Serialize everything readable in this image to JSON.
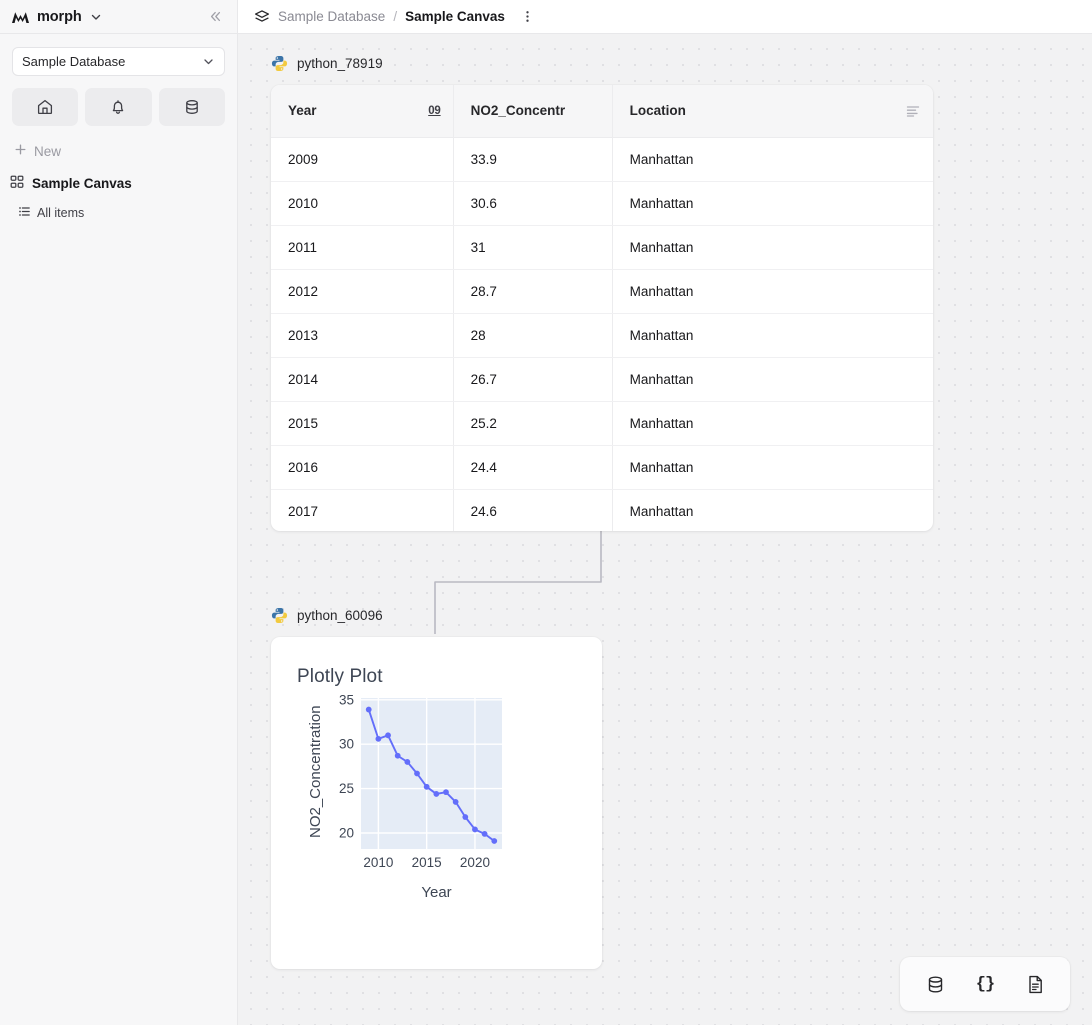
{
  "sidebar": {
    "brand": "morph",
    "brand_icon": "morph-logo-icon",
    "chevron_icon": "chevron-down-icon",
    "collapse_icon": "chevrons-left-icon",
    "db_select": {
      "value": "Sample Database",
      "arrow_icon": "chevron-down-icon"
    },
    "icon_buttons": [
      {
        "name": "home-icon",
        "label": "Home"
      },
      {
        "name": "bell-icon",
        "label": "Notifications"
      },
      {
        "name": "database-icon",
        "label": "Database"
      }
    ],
    "new_label": "New",
    "new_icon": "plus-icon",
    "canvas_item": {
      "label": "Sample Canvas",
      "icon": "grid-icon"
    },
    "all_items": {
      "label": "All items",
      "icon": "list-icon"
    }
  },
  "topbar": {
    "breadcrumb_icon": "layers-icon",
    "database": "Sample Database",
    "separator": "/",
    "canvas": "Sample Canvas",
    "menu_icon": "dots-vertical-icon"
  },
  "canvas": {
    "nodes": [
      {
        "id": "table-node",
        "label": "python_78919",
        "icon": "python-logo-icon"
      },
      {
        "id": "plot-node",
        "label": "python_60096",
        "icon": "python-logo-icon"
      }
    ],
    "table": {
      "columns": [
        {
          "label": "Year",
          "type_icon": "number-09-icon"
        },
        {
          "label": "NO2_Concentr",
          "type_icon": ""
        },
        {
          "label": "Location",
          "type_icon": "text-align-icon"
        }
      ],
      "rows": [
        [
          "2009",
          "33.9",
          "Manhattan"
        ],
        [
          "2010",
          "30.6",
          "Manhattan"
        ],
        [
          "2011",
          "31",
          "Manhattan"
        ],
        [
          "2012",
          "28.7",
          "Manhattan"
        ],
        [
          "2013",
          "28",
          "Manhattan"
        ],
        [
          "2014",
          "26.7",
          "Manhattan"
        ],
        [
          "2015",
          "25.2",
          "Manhattan"
        ],
        [
          "2016",
          "24.4",
          "Manhattan"
        ],
        [
          "2017",
          "24.6",
          "Manhattan"
        ]
      ]
    },
    "plot": {
      "title": "Plotly Plot"
    }
  },
  "toolbar": {
    "buttons": [
      {
        "name": "database-icon",
        "label": "Database"
      },
      {
        "name": "json-braces-icon",
        "label": "{}"
      },
      {
        "name": "document-icon",
        "label": "Document"
      }
    ]
  },
  "colors": {
    "accent": "#636efa",
    "plot_bg": "#e5ecf6",
    "canvas_bg": "#f2f2f3",
    "sidebar_bg": "#f7f7f8"
  },
  "chart_data": {
    "type": "line",
    "title": "Plotly Plot",
    "xlabel": "Year",
    "ylabel": "NO2_Concentration",
    "x": [
      2009,
      2010,
      2011,
      2012,
      2013,
      2014,
      2015,
      2016,
      2017,
      2018,
      2019,
      2020,
      2021,
      2022
    ],
    "values": [
      33.9,
      30.6,
      31.0,
      28.7,
      28.0,
      26.7,
      25.2,
      24.4,
      24.6,
      23.5,
      21.8,
      20.4,
      19.9,
      19.1
    ],
    "series": [
      {
        "name": "NO2_Concentration",
        "values": [
          33.9,
          30.6,
          31.0,
          28.7,
          28.0,
          26.7,
          25.2,
          24.4,
          24.6,
          23.5,
          21.8,
          20.4,
          19.9,
          19.1
        ]
      }
    ],
    "xlim": [
      2008.2,
      2022.8
    ],
    "ylim": [
      18.2,
      35.2
    ],
    "xticks": [
      2010,
      2015,
      2020
    ],
    "yticks": [
      20,
      25,
      30,
      35
    ],
    "grid": true,
    "legend": "none",
    "line_color": "#636efa",
    "marker": "circle",
    "plot_bgcolor": "#e5ecf6"
  }
}
